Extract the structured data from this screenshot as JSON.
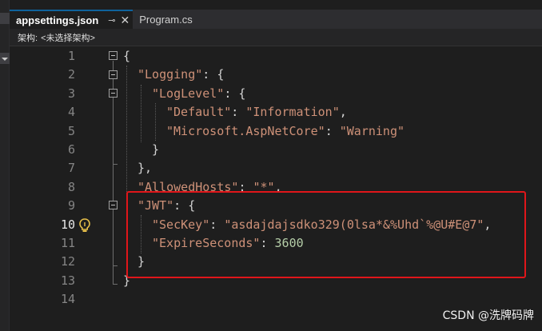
{
  "tabs": [
    {
      "label": "appsettings.json",
      "active": true
    },
    {
      "label": "Program.cs",
      "active": false
    }
  ],
  "tab_icons": {
    "pin": "⊸",
    "close": "✕"
  },
  "navbar": {
    "label": "架构:",
    "value": "<未选择架构>"
  },
  "editor": {
    "current_line": "10",
    "lines": [
      {
        "num": "1"
      },
      {
        "num": "2"
      },
      {
        "num": "3"
      },
      {
        "num": "4"
      },
      {
        "num": "5"
      },
      {
        "num": "6"
      },
      {
        "num": "7"
      },
      {
        "num": "8"
      },
      {
        "num": "9"
      },
      {
        "num": "10"
      },
      {
        "num": "11"
      },
      {
        "num": "12"
      },
      {
        "num": "13"
      },
      {
        "num": "14"
      }
    ],
    "tokens": {
      "l1": "{",
      "l2_key": "\"Logging\"",
      "l2_p": ": {",
      "l3_key": "\"LogLevel\"",
      "l3_p": ": {",
      "l4_key": "\"Default\"",
      "l4_c": ": ",
      "l4_val": "\"Information\"",
      "l4_e": ",",
      "l5_key": "\"Microsoft.AspNetCore\"",
      "l5_c": ": ",
      "l5_val": "\"Warning\"",
      "l6": "}",
      "l7": "},",
      "l8_key": "\"AllowedHosts\"",
      "l8_c": ": ",
      "l8_val": "\"*\"",
      "l8_e": ",",
      "l9_key": "\"JWT\"",
      "l9_p": ": {",
      "l10_key": "\"SecKey\"",
      "l10_c": ": ",
      "l10_val": "\"asdajdajsdko329(0lsa*&%Uhd`%@U#E@7\"",
      "l10_e": ",",
      "l11_key": "\"ExpireSeconds\"",
      "l11_c": ": ",
      "l11_val": "3600",
      "l12": "}",
      "l13": "}"
    }
  },
  "colors": {
    "key": "#9cdcfe",
    "string": "#ce9178",
    "number": "#b5cea8",
    "highlight": "#e0161a"
  },
  "watermark": "CSDN @洗牌码牌"
}
